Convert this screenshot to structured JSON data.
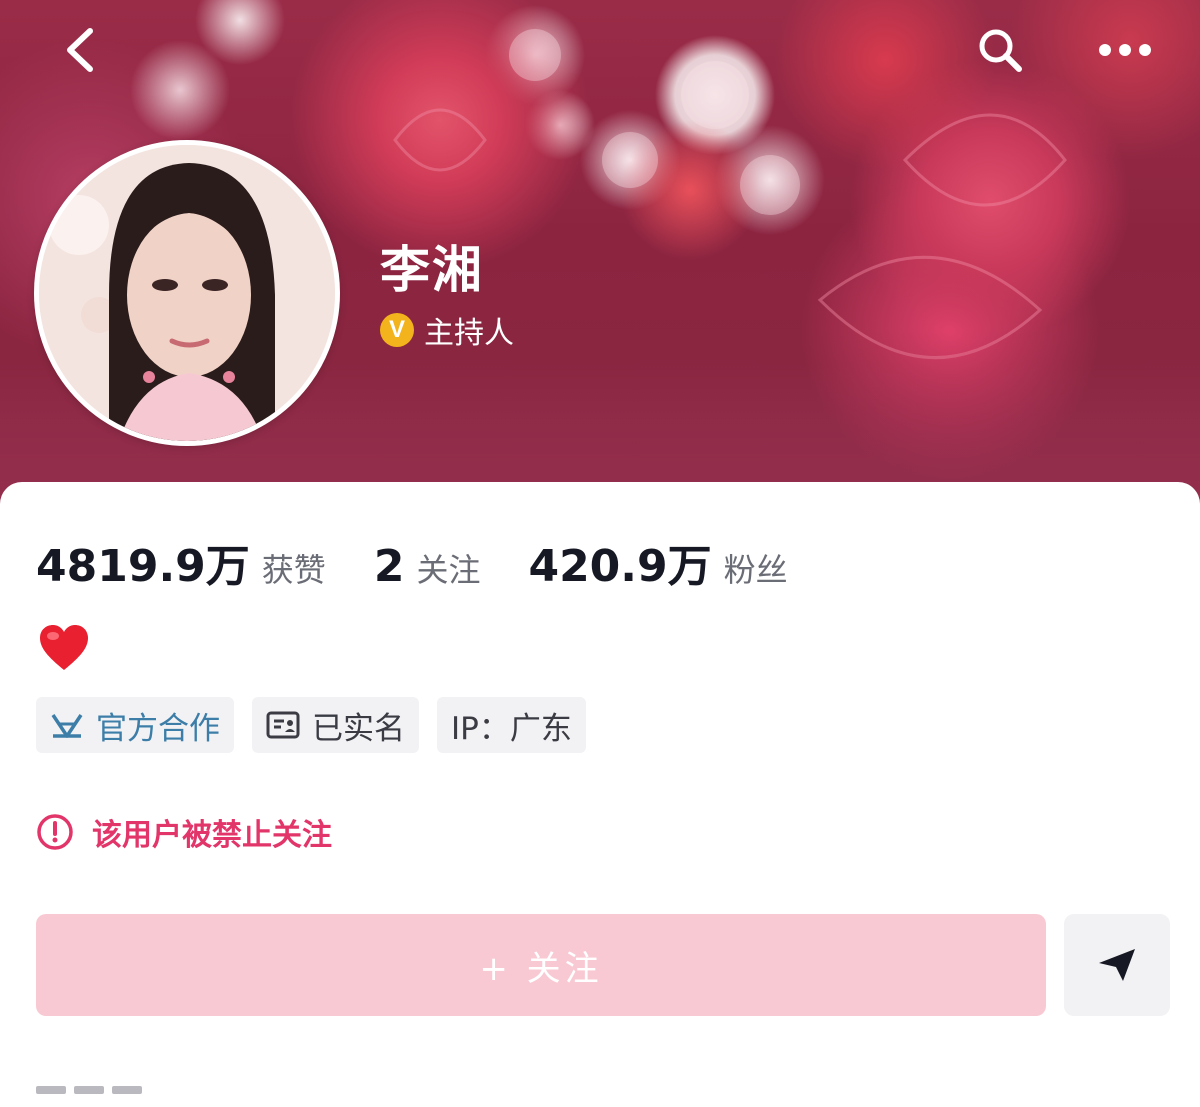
{
  "header": {
    "back_icon": "chevron-left-icon",
    "search_icon": "search-icon",
    "more_icon": "more-horizontal-icon"
  },
  "profile": {
    "name": "李湘",
    "verification": {
      "icon": "v-badge-icon",
      "badge_letter": "V",
      "label": "主持人",
      "color": "#f3b31c"
    }
  },
  "stats": [
    {
      "value": "4819.9万",
      "label": "获赞"
    },
    {
      "value": "2",
      "label": "关注"
    },
    {
      "value": "420.9万",
      "label": "粉丝"
    }
  ],
  "bio": {
    "emoji_icon": "red-heart-icon"
  },
  "tags": [
    {
      "icon": "official-cooperation-icon",
      "label": "官方合作"
    },
    {
      "icon": "id-card-icon",
      "label": "已实名"
    },
    {
      "label": "IP：广东"
    }
  ],
  "warning": {
    "icon": "alert-circle-icon",
    "text": "该用户被禁止关注",
    "color": "#e2356a"
  },
  "actions": {
    "follow_label": "+ 关注",
    "send_icon": "send-message-icon"
  },
  "colors": {
    "follow_disabled": "#f9c9d3",
    "stat_text": "#161823",
    "muted_text": "#6b6d76"
  }
}
